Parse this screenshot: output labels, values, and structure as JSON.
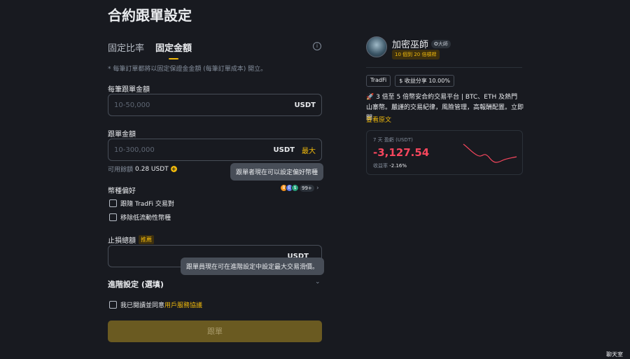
{
  "page": {
    "title": "合約跟單設定"
  },
  "tabs": [
    {
      "label": "固定比率",
      "active": false
    },
    {
      "label": "固定金額",
      "active": true
    }
  ],
  "note": "* 每筆訂單都將以固定保證金金額 (每筆訂單成本) 開立。",
  "per_order": {
    "label": "每筆跟單金額",
    "placeholder": "10-50,000",
    "unit": "USDT"
  },
  "copy_amount": {
    "label": "跟單金額",
    "placeholder": "10-300,000",
    "unit": "USDT",
    "max_label": "最大"
  },
  "available": {
    "label": "可用餘額",
    "value": "0.28 USDT",
    "add_icon": "plus-circle-icon"
  },
  "tooltip1": "跟單者現在可以設定偏好幣種",
  "coin_pref": {
    "label": "幣種偏好",
    "count": "99+",
    "coins": [
      "B",
      "E",
      "$"
    ],
    "chevron_icon": "chevron-right-icon"
  },
  "options": [
    {
      "label": "跟隨 TradFi 交易對",
      "checked": false
    },
    {
      "label": "移除低流動性幣種",
      "checked": false
    }
  ],
  "stop_loss": {
    "label": "止損總額",
    "badge": "推薦",
    "unit": "USDT"
  },
  "tooltip2": "跟單員現在可在進階設定中設定最大交易滑價。",
  "advanced": {
    "label": "進階設定 (選填)",
    "chevron_icon": "chevron-down-icon"
  },
  "agreement": {
    "prefix": "我已閱讀並同意",
    "link": "用戶服務協議"
  },
  "submit": {
    "label": "跟單"
  },
  "trader": {
    "name": "加密巫師",
    "rank": "大師",
    "subtitle": "10 個到 20 倍槓桿",
    "tags": [
      "TradFi",
      "收益分享 10.00%"
    ],
    "description": "🚀 3 倍至 5 倍幣安合約交易平台 | BTC、ETH 及熱門山寨幣。嚴謹的交易紀律，風險管理，高報酬配置。立即關",
    "read_more": "查看原文",
    "pnl_label": "7 天 盈虧 (USDT)",
    "pnl_value": "-3,127.54",
    "roi_label": "收益率",
    "roi_value": "-2.16%"
  },
  "chat": {
    "label": "聊天室"
  },
  "colors": {
    "accent": "#f0b90b",
    "negative": "#f6465d",
    "background": "#181a20"
  }
}
